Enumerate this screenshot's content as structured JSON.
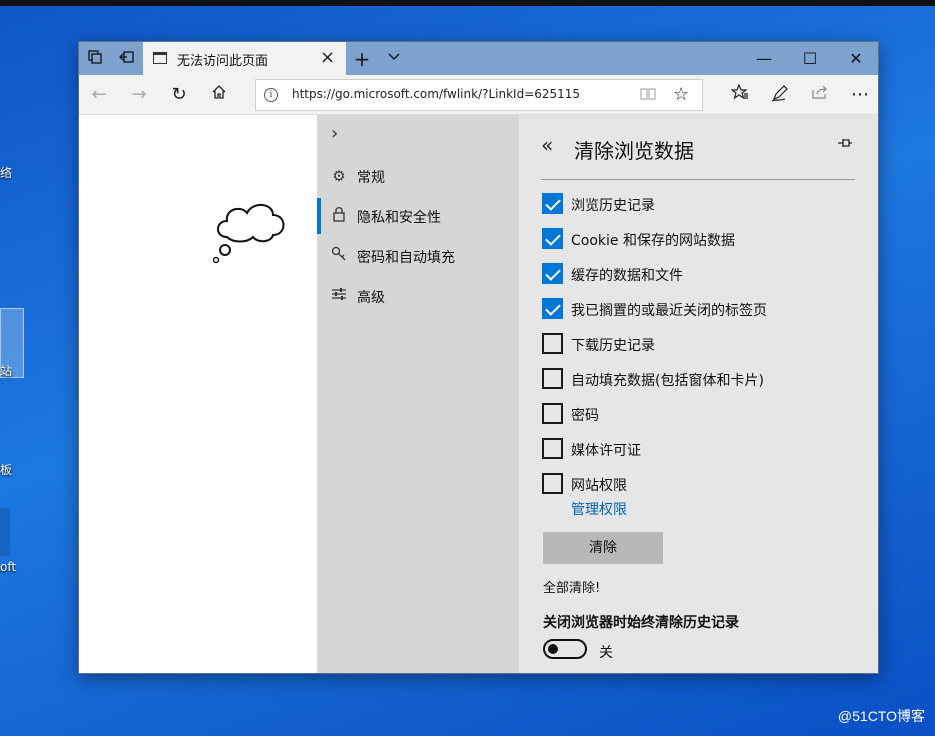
{
  "desktop": {
    "icons": [
      {
        "label": "络"
      },
      {
        "label": "站"
      },
      {
        "label": "板"
      },
      {
        "label": "oft"
      }
    ],
    "watermark": "@51CTO博客"
  },
  "browser": {
    "tab_title": "无法访问此页面",
    "new_tab_symbol": "+",
    "url": "https://go.microsoft.com/fwlink/?LinkId=625115",
    "window_controls": {
      "minimize": "—",
      "maximize": "☐",
      "close": "✕"
    }
  },
  "settings_nav": {
    "items": [
      {
        "label": "常规",
        "icon": "gear-icon"
      },
      {
        "label": "隐私和安全性",
        "icon": "lock-icon",
        "active": true
      },
      {
        "label": "密码和自动填充",
        "icon": "key-icon"
      },
      {
        "label": "高级",
        "icon": "sliders-icon"
      }
    ]
  },
  "clear_panel": {
    "title": "清除浏览数据",
    "options": [
      {
        "label": "浏览历史记录",
        "checked": true
      },
      {
        "label": "Cookie 和保存的网站数据",
        "checked": true
      },
      {
        "label": "缓存的数据和文件",
        "checked": true
      },
      {
        "label": "我已搁置的或最近关闭的标签页",
        "checked": true
      },
      {
        "label": "下载历史记录",
        "checked": false
      },
      {
        "label": "自动填充数据(包括窗体和卡片)",
        "checked": false
      },
      {
        "label": "密码",
        "checked": false
      },
      {
        "label": "媒体许可证",
        "checked": false
      },
      {
        "label": "网站权限",
        "checked": false
      }
    ],
    "manage_link": "管理权限",
    "clear_button": "清除",
    "status_note": "全部清除!",
    "always_clear_label": "关闭浏览器时始终清除历史记录",
    "toggle_state": "关",
    "toggle_on": false
  }
}
